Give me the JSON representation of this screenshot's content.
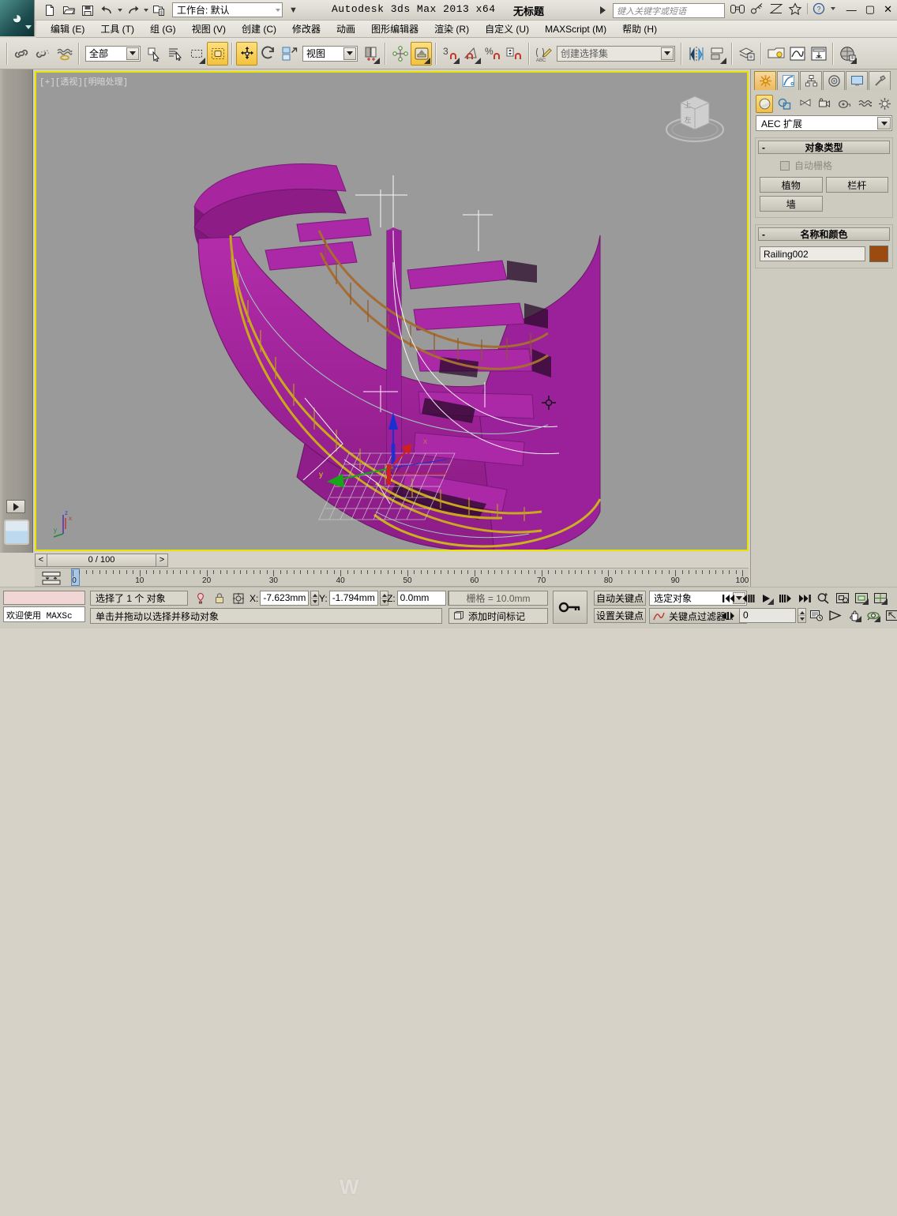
{
  "app": {
    "title": "Autodesk 3ds Max  2013 x64",
    "document_title": "无标题",
    "logo_name": "3ds-max-logo"
  },
  "quick_access": {
    "workspace_label": "工作台: 默认",
    "buttons": [
      {
        "name": "new-file",
        "icon": "new-document-icon"
      },
      {
        "name": "open-file",
        "icon": "open-folder-icon"
      },
      {
        "name": "save-file",
        "icon": "save-disk-icon"
      },
      {
        "name": "undo",
        "icon": "undo-arrow-icon"
      },
      {
        "name": "redo",
        "icon": "redo-arrow-icon"
      },
      {
        "name": "project-folder",
        "icon": "project-folder-icon"
      }
    ]
  },
  "search": {
    "placeholder": "键入关键字或短语"
  },
  "title_icons": [
    {
      "name": "binoculars-icon",
      "label": "查找"
    },
    {
      "name": "key-icon",
      "label": "登录"
    },
    {
      "name": "exchange-icon",
      "label": "交换"
    },
    {
      "name": "star-icon",
      "label": "收藏"
    },
    {
      "name": "help-icon",
      "label": "?"
    }
  ],
  "window_controls": {
    "minimize": "—",
    "maximize": "▢",
    "close": "✕"
  },
  "menu": {
    "items": [
      "编辑 (E)",
      "工具 (T)",
      "组 (G)",
      "视图 (V)",
      "创建 (C)",
      "修改器",
      "动画",
      "图形编辑器",
      "渲染 (R)",
      "自定义 (U)",
      "MAXScript (M)",
      "帮助 (H)"
    ]
  },
  "toolbar": {
    "selection_filter": "全部",
    "reference_coord": "视图",
    "named_set": "创建选择集",
    "buttons": [
      {
        "name": "select-link-button",
        "icon": "link-icon",
        "active": false
      },
      {
        "name": "unlink-selection-button",
        "icon": "unlink-icon",
        "active": false
      },
      {
        "name": "bind-to-space-warp-button",
        "icon": "space-warp-icon",
        "active": false
      },
      {
        "name": "select-object-button",
        "icon": "select-arrow-icon",
        "active": false
      },
      {
        "name": "select-by-name-button",
        "icon": "select-by-name-icon",
        "active": false
      },
      {
        "name": "select-region-button",
        "icon": "rect-marquee-icon",
        "active": false
      },
      {
        "name": "window-crossing-button",
        "icon": "window-crossing-icon",
        "active": true
      },
      {
        "name": "select-and-move-button",
        "icon": "move-gizmo-icon",
        "active": true
      },
      {
        "name": "select-and-rotate-button",
        "icon": "rotate-gizmo-icon",
        "active": false
      },
      {
        "name": "select-and-scale-button",
        "icon": "scale-gizmo-icon",
        "active": false
      },
      {
        "name": "mirror-button",
        "icon": "mirror-icon",
        "active": false
      },
      {
        "name": "align-button",
        "icon": "align-icon",
        "active": false
      },
      {
        "name": "use-pivot-center-button",
        "icon": "pivot-center-icon",
        "active": true
      },
      {
        "name": "snap-toggle-button",
        "icon": "snap-3-icon",
        "active": false
      },
      {
        "name": "angle-snap-button",
        "icon": "angle-snap-icon",
        "active": false
      },
      {
        "name": "percent-snap-button",
        "icon": "percent-snap-icon",
        "active": false
      },
      {
        "name": "spinner-snap-button",
        "icon": "spinner-snap-icon",
        "active": false
      },
      {
        "name": "edit-named-selection-button",
        "icon": "edit-named-set-icon",
        "active": false
      },
      {
        "name": "mirror-objects-button",
        "icon": "mirror-objects-icon",
        "active": false
      },
      {
        "name": "align-objects-button",
        "icon": "align-objects-icon",
        "active": false
      },
      {
        "name": "layer-manager-button",
        "icon": "layers-icon",
        "active": false
      },
      {
        "name": "light-lister-button",
        "icon": "light-icon",
        "active": false
      },
      {
        "name": "curve-editor-button",
        "icon": "curve-editor-icon",
        "active": false
      },
      {
        "name": "schematic-view-button",
        "icon": "schematic-view-icon",
        "active": false
      },
      {
        "name": "material-editor-button",
        "icon": "material-sphere-icon",
        "active": false
      }
    ]
  },
  "viewport": {
    "label": "[+][透视][明暗处理]",
    "background_color": "#9a9a9a",
    "border_color": "#e8e400",
    "view_cube": {
      "top_face": "上",
      "side_face": "左"
    },
    "axis_tripod": {
      "x": "x",
      "y": "y",
      "z": "z"
    },
    "model": {
      "name": "spiral-staircase",
      "stair_color": "#a0229a",
      "railing_gold_color": "#c9a81e",
      "railing_brown_color": "#a06a32",
      "selection_highlight": "#ffffff"
    }
  },
  "command_panel": {
    "tabs": [
      {
        "name": "create-tab",
        "icon": "create-star-icon",
        "active": true
      },
      {
        "name": "modify-tab",
        "icon": "modify-curve-icon",
        "active": false
      },
      {
        "name": "hierarchy-tab",
        "icon": "hierarchy-icon",
        "active": false
      },
      {
        "name": "motion-tab",
        "icon": "motion-wheel-icon",
        "active": false
      },
      {
        "name": "display-tab",
        "icon": "display-monitor-icon",
        "active": false
      },
      {
        "name": "utilities-tab",
        "icon": "utilities-hammer-icon",
        "active": false
      }
    ],
    "categories": [
      {
        "name": "geometry-category",
        "icon": "geometry-sphere-icon",
        "active": true
      },
      {
        "name": "shapes-category",
        "icon": "shapes-icon",
        "active": false
      },
      {
        "name": "lights-category",
        "icon": "light-cone-icon",
        "active": false
      },
      {
        "name": "cameras-category",
        "icon": "camera-icon",
        "active": false
      },
      {
        "name": "helpers-category",
        "icon": "tape-measure-icon",
        "active": false
      },
      {
        "name": "space-warps-category",
        "icon": "space-warp-wave-icon",
        "active": false
      },
      {
        "name": "systems-category",
        "icon": "systems-gear-icon",
        "active": false
      }
    ],
    "subcategory": "AEC 扩展",
    "object_type": {
      "title": "对象类型",
      "collapse_glyph": "-",
      "auto_grid_label": "自动栅格",
      "auto_grid_checked": false,
      "buttons": [
        "植物",
        "栏杆",
        "墙"
      ]
    },
    "name_and_color": {
      "title": "名称和颜色",
      "collapse_glyph": "-",
      "object_name": "Railing002",
      "color": "#9b4a10"
    }
  },
  "timeline": {
    "slider_label": "0 / 100",
    "prev_frame": "<",
    "next_frame": ">",
    "ticks": [
      0,
      10,
      20,
      30,
      40,
      50,
      60,
      70,
      80,
      90,
      100
    ],
    "current_frame": 0,
    "key_mode_icon": "key-mode-icon"
  },
  "status_bar": {
    "selection_status": "选择了 1 个 对象",
    "prompt": "单击并拖动以选择并移动对象",
    "maxscript_listener": "欢迎使用 MAXSc",
    "coords": {
      "x_label": "X:",
      "x_value": "-7.623mm",
      "y_label": "Y:",
      "y_value": "-1.794mm",
      "z_label": "Z:",
      "z_value": "0.0mm"
    },
    "grid_info": "栅格 = 10.0mm",
    "add_time_tag": "添加时间标记",
    "icons": [
      {
        "name": "isolate-selection-icon"
      },
      {
        "name": "selection-lock-icon"
      },
      {
        "name": "absolute-relative-mode-icon"
      }
    ]
  },
  "animation_controls": {
    "auto_key": "自动关键点",
    "set_key": "设置关键点",
    "selection_set": "选定对象",
    "key_filters": "关键点过滤器...",
    "key_toggle_icon": "big-key-icon",
    "frame_value": "0",
    "playback": [
      {
        "name": "goto-start-button",
        "icon": "goto-start-icon"
      },
      {
        "name": "previous-frame-button",
        "icon": "prev-frame-icon"
      },
      {
        "name": "play-animation-button",
        "icon": "play-icon"
      },
      {
        "name": "next-frame-button",
        "icon": "next-frame-icon"
      },
      {
        "name": "goto-end-button",
        "icon": "goto-end-icon"
      },
      {
        "name": "time-configuration-button",
        "icon": "clock-config-icon"
      }
    ],
    "viewport_nav": [
      {
        "name": "zoom-button",
        "icon": "zoom-magnifier-icon"
      },
      {
        "name": "zoom-extents-button",
        "icon": "zoom-extents-icon"
      },
      {
        "name": "zoom-region-button",
        "icon": "zoom-region-icon"
      },
      {
        "name": "zoom-all-button",
        "icon": "zoom-all-icon"
      },
      {
        "name": "field-of-view-button",
        "icon": "fov-icon"
      },
      {
        "name": "pan-button",
        "icon": "pan-hand-icon"
      },
      {
        "name": "orbit-button",
        "icon": "orbit-icon"
      },
      {
        "name": "maximize-viewport-button",
        "icon": "maximize-viewport-icon"
      }
    ]
  },
  "watermark": {
    "text": "W"
  }
}
